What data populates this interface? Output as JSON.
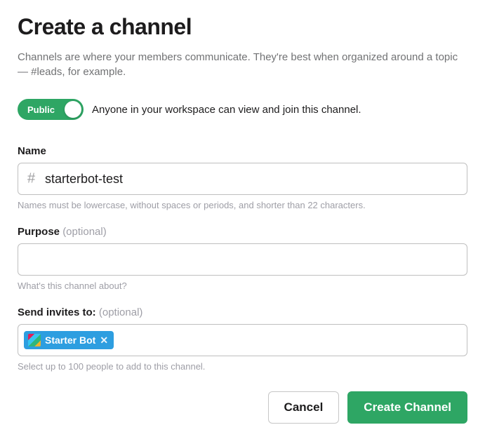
{
  "title": "Create a channel",
  "subtitle": "Channels are where your members communicate. They're best when organized around a topic — #leads, for example.",
  "toggle": {
    "label": "Public",
    "description": "Anyone in your workspace can view and join this channel."
  },
  "name": {
    "label": "Name",
    "value": "starterbot-test",
    "help": "Names must be lowercase, without spaces or periods, and shorter than 22 characters."
  },
  "purpose": {
    "label": "Purpose ",
    "optional": "(optional)",
    "value": "",
    "help": "What's this channel about?"
  },
  "invites": {
    "label": "Send invites to: ",
    "optional": "(optional)",
    "token": "Starter Bot",
    "help": "Select up to 100 people to add to this channel."
  },
  "actions": {
    "cancel": "Cancel",
    "create": "Create Channel"
  }
}
